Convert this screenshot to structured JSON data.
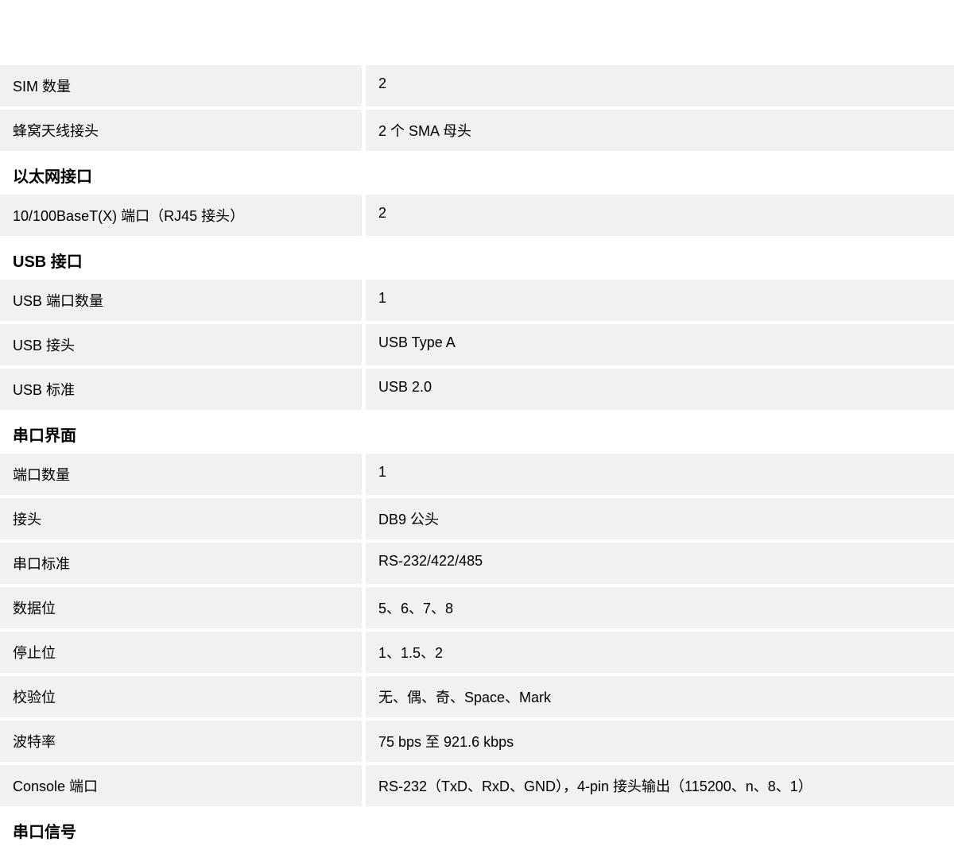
{
  "sections": [
    {
      "title": null,
      "rows": [
        {
          "label": "SIM 数量",
          "value": "2"
        },
        {
          "label": "蜂窝天线接头",
          "value": "2 个 SMA 母头"
        }
      ]
    },
    {
      "title": "以太网接口",
      "rows": [
        {
          "label": "10/100BaseT(X) 端口（RJ45 接头）",
          "value": "2"
        }
      ]
    },
    {
      "title": "USB 接口",
      "rows": [
        {
          "label": "USB 端口数量",
          "value": "1"
        },
        {
          "label": "USB 接头",
          "value": "USB Type A"
        },
        {
          "label": "USB 标准",
          "value": "USB 2.0"
        }
      ]
    },
    {
      "title": "串口界面",
      "rows": [
        {
          "label": "端口数量",
          "value": "1"
        },
        {
          "label": "接头",
          "value": "DB9 公头"
        },
        {
          "label": "串口标准",
          "value": "RS-232/422/485"
        },
        {
          "label": "数据位",
          "value": "5、6、7、8"
        },
        {
          "label": "停止位",
          "value": "1、1.5、2"
        },
        {
          "label": "校验位",
          "value": "无、偶、奇、Space、Mark"
        },
        {
          "label": "波特率",
          "value": "75 bps 至 921.6 kbps"
        },
        {
          "label": "Console 端口",
          "value": "RS-232（TxD、RxD、GND），4-pin 接头输出（115200、n、8、1）"
        }
      ]
    },
    {
      "title": "串口信号",
      "rows": []
    }
  ]
}
